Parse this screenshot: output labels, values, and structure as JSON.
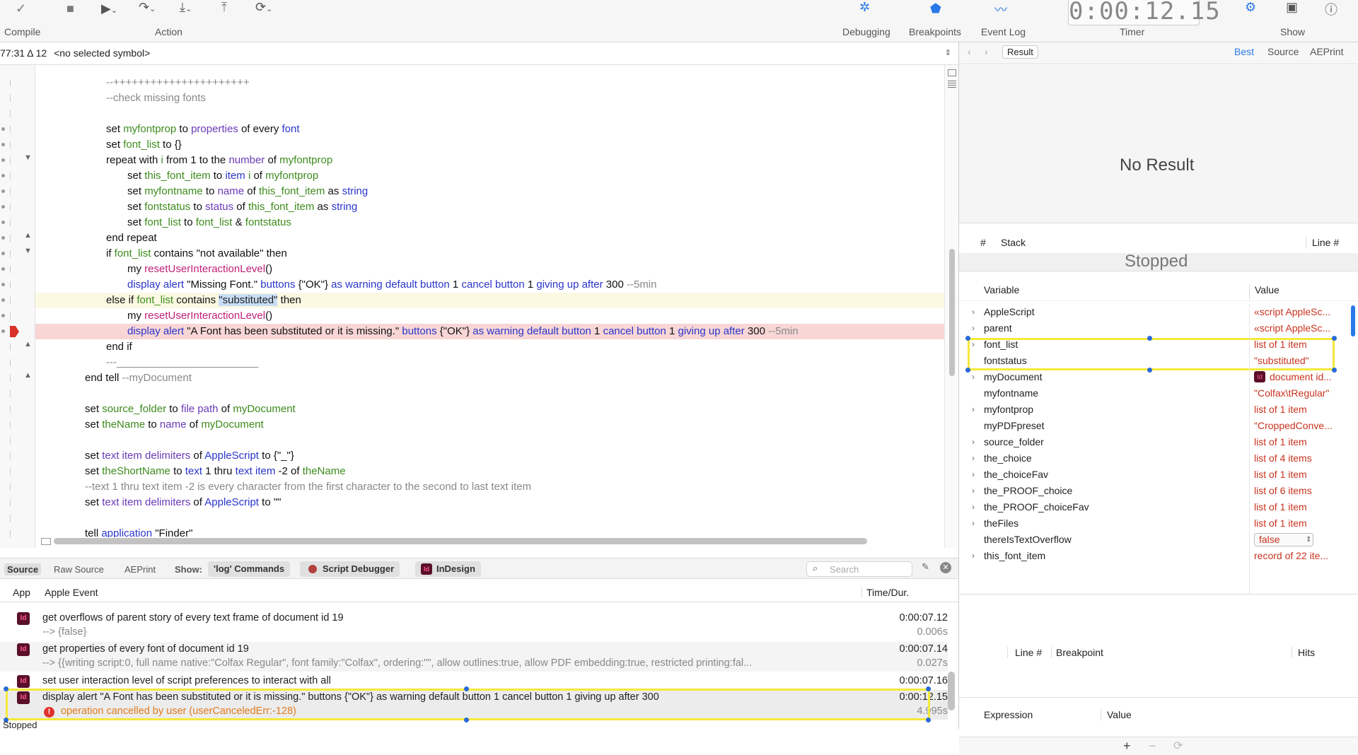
{
  "toolbar": {
    "compile": "Compile",
    "action": "Action",
    "debugging": "Debugging",
    "breakpoints": "Breakpoints",
    "event_log": "Event Log",
    "timer_label": "Timer",
    "show": "Show",
    "timer_value": "0:00:12.15"
  },
  "symbol_bar": {
    "position": "77:31 Δ 12",
    "symbol": "<no selected symbol>"
  },
  "code_lines": [
    {
      "t": [
        [
          "cm",
          "--++++++++++++++++++++++"
        ]
      ]
    },
    {
      "t": [
        [
          "cm",
          "--check missing fonts"
        ]
      ]
    },
    {
      "t": []
    },
    {
      "t": [
        [
          "kw",
          "set "
        ],
        [
          "v",
          "myfontprop"
        ],
        [
          "kw",
          " to "
        ],
        [
          "p",
          "properties"
        ],
        [
          "kw",
          " of every "
        ],
        [
          "cls",
          "font"
        ]
      ]
    },
    {
      "t": [
        [
          "kw",
          "set "
        ],
        [
          "v",
          "font_list"
        ],
        [
          "kw",
          " to {}"
        ]
      ]
    },
    {
      "t": [
        [
          "kw",
          "repeat with "
        ],
        [
          "v",
          "i"
        ],
        [
          "kw",
          " from 1 to the "
        ],
        [
          "p",
          "number"
        ],
        [
          "kw",
          " of "
        ],
        [
          "v",
          "myfontprop"
        ]
      ]
    },
    {
      "t": [
        [
          "kw",
          "set "
        ],
        [
          "v",
          "this_font_item"
        ],
        [
          "kw",
          " to "
        ],
        [
          "cls",
          "item"
        ],
        [
          "kw",
          " "
        ],
        [
          "v",
          "i"
        ],
        [
          "kw",
          " of "
        ],
        [
          "v",
          "myfontprop"
        ]
      ]
    },
    {
      "t": [
        [
          "kw",
          "set "
        ],
        [
          "v",
          "myfontname"
        ],
        [
          "kw",
          " to "
        ],
        [
          "p",
          "name"
        ],
        [
          "kw",
          " of "
        ],
        [
          "v",
          "this_font_item"
        ],
        [
          "kw",
          " as "
        ],
        [
          "cls",
          "string"
        ]
      ]
    },
    {
      "t": [
        [
          "kw",
          "set "
        ],
        [
          "v",
          "fontstatus"
        ],
        [
          "kw",
          " to "
        ],
        [
          "p",
          "status"
        ],
        [
          "kw",
          " of "
        ],
        [
          "v",
          "this_font_item"
        ],
        [
          "kw",
          " as "
        ],
        [
          "cls",
          "string"
        ]
      ]
    },
    {
      "t": [
        [
          "kw",
          "set "
        ],
        [
          "v",
          "font_list"
        ],
        [
          "kw",
          " to "
        ],
        [
          "v",
          "font_list"
        ],
        [
          "kw",
          " & "
        ],
        [
          "v",
          "fontstatus"
        ]
      ]
    },
    {
      "t": [
        [
          "kw",
          "end repeat"
        ]
      ]
    },
    {
      "t": [
        [
          "kw",
          "if "
        ],
        [
          "v",
          "font_list"
        ],
        [
          "kw",
          " contains \"not available\" then"
        ]
      ]
    },
    {
      "t": [
        [
          "kw",
          "my "
        ],
        [
          "h",
          "resetUserInteractionLevel"
        ],
        [
          "kw",
          "()"
        ]
      ]
    },
    {
      "t": [
        [
          "cls",
          "display alert"
        ],
        [
          "kw",
          " \"Missing Font.\" "
        ],
        [
          "cls",
          "buttons"
        ],
        [
          "kw",
          " {\"OK\"} "
        ],
        [
          "cls",
          "as warning default button"
        ],
        [
          "kw",
          " 1 "
        ],
        [
          "cls",
          "cancel button"
        ],
        [
          "kw",
          " 1 "
        ],
        [
          "cls",
          "giving up after"
        ],
        [
          "kw",
          " 300 "
        ],
        [
          "cm",
          "--5min"
        ]
      ]
    },
    {
      "t": [
        [
          "kw",
          "else if "
        ],
        [
          "v",
          "font_list"
        ],
        [
          "kw",
          " contains "
        ],
        [
          "sel",
          "\"substituted\""
        ],
        [
          "kw",
          " then"
        ]
      ]
    },
    {
      "t": [
        [
          "kw",
          "my "
        ],
        [
          "h",
          "resetUserInteractionLevel"
        ],
        [
          "kw",
          "()"
        ]
      ]
    },
    {
      "t": [
        [
          "cls",
          "display alert"
        ],
        [
          "kw",
          " \"A Font has been substituted or it is missing.\" "
        ],
        [
          "cls",
          "buttons"
        ],
        [
          "kw",
          " {\"OK\"} "
        ],
        [
          "cls",
          "as warning default button"
        ],
        [
          "kw",
          " 1 "
        ],
        [
          "cls",
          "cancel button"
        ],
        [
          "kw",
          " 1 "
        ],
        [
          "cls",
          "giving up after"
        ],
        [
          "kw",
          " 300 "
        ],
        [
          "cm",
          "--5min"
        ]
      ]
    },
    {
      "t": [
        [
          "kw",
          "end if"
        ]
      ]
    },
    {
      "t": [
        [
          "cm",
          "---________________________"
        ]
      ]
    },
    {
      "t": [
        [
          "kw",
          "end tell "
        ],
        [
          "cm",
          "--myDocument"
        ]
      ]
    },
    {
      "t": []
    },
    {
      "t": [
        [
          "kw",
          "set "
        ],
        [
          "v",
          "source_folder"
        ],
        [
          "kw",
          " to "
        ],
        [
          "p",
          "file path"
        ],
        [
          "kw",
          " of "
        ],
        [
          "v",
          "myDocument"
        ]
      ]
    },
    {
      "t": [
        [
          "kw",
          "set "
        ],
        [
          "v",
          "theName"
        ],
        [
          "kw",
          " to "
        ],
        [
          "p",
          "name"
        ],
        [
          "kw",
          " of "
        ],
        [
          "v",
          "myDocument"
        ]
      ]
    },
    {
      "t": []
    },
    {
      "t": [
        [
          "kw",
          "set "
        ],
        [
          "p",
          "text item delimiters"
        ],
        [
          "kw",
          " of "
        ],
        [
          "cls",
          "AppleScript"
        ],
        [
          "kw",
          " to {\"_\"}"
        ]
      ]
    },
    {
      "t": [
        [
          "kw",
          "set "
        ],
        [
          "v",
          "theShortName"
        ],
        [
          "kw",
          " to "
        ],
        [
          "cls",
          "text"
        ],
        [
          "kw",
          " 1 thru "
        ],
        [
          "cls",
          "text item"
        ],
        [
          "kw",
          " -2 of "
        ],
        [
          "v",
          "theName"
        ]
      ]
    },
    {
      "t": [
        [
          "cm",
          "--text 1 thru text item -2 is every character from the first character to the second to last text item"
        ]
      ]
    },
    {
      "t": [
        [
          "kw",
          "set "
        ],
        [
          "p",
          "text item delimiters"
        ],
        [
          "kw",
          " of "
        ],
        [
          "cls",
          "AppleScript"
        ],
        [
          "kw",
          " to \"\""
        ]
      ]
    },
    {
      "t": []
    },
    {
      "t": [
        [
          "kw",
          "tell "
        ],
        [
          "cls",
          "application"
        ],
        [
          "kw",
          " \"Finder\""
        ]
      ]
    }
  ],
  "log_bar": {
    "source": "Source",
    "raw_source": "Raw Source",
    "aeprint": "AEPrint",
    "show": "Show:",
    "log_commands": "'log' Commands",
    "script_debugger": "Script Debugger",
    "indesign": "InDesign",
    "search_placeholder": "Search"
  },
  "log_header": {
    "app": "App",
    "event": "Apple Event",
    "time": "Time/Dur."
  },
  "log_rows": [
    {
      "event": "get overflows of parent story of every text frame of document id 19",
      "result": "--> {false}",
      "time": "0:00:07.12",
      "dur": "0.006s"
    },
    {
      "event": "get properties of every font of document id 19",
      "result": "--> {{writing script:0, full name native:\"Colfax Regular\", font family:\"Colfax\", ordering:\"\", allow outlines:true, allow PDF embedding:true, restricted printing:fal...",
      "time": "0:00:07.14",
      "dur": "0.027s"
    },
    {
      "event": "set user interaction level of script preferences to interact with all",
      "result": "",
      "time": "0:00:07.16",
      "dur": ""
    },
    {
      "event": "display alert \"A Font has been substituted or it is missing.\" buttons {\"OK\"} as warning default button 1 cancel button 1 giving up after 300",
      "result": "operation cancelled by user (userCanceledErr:-128)",
      "time": "0:00:12.15",
      "dur": "4.995s"
    }
  ],
  "status": "Stopped",
  "result_bar": {
    "result": "Result",
    "best": "Best",
    "source": "Source",
    "aeprint": "AEPrint"
  },
  "result_panel": {
    "empty": "No Result"
  },
  "stack": {
    "num": "#",
    "stack": "Stack",
    "line": "Line #",
    "status": "Stopped"
  },
  "vars_header": {
    "variable": "Variable",
    "value": "Value"
  },
  "variables": [
    {
      "name": "AppleScript",
      "value": "«script AppleSc...",
      "exp": true
    },
    {
      "name": "parent",
      "value": "«script AppleSc...",
      "exp": true
    },
    {
      "name": "font_list",
      "value": "list of 1 item",
      "exp": true
    },
    {
      "name": "fontstatus",
      "value": "\"substituted\"",
      "exp": false
    },
    {
      "name": "myDocument",
      "value": "document id...",
      "exp": true
    },
    {
      "name": "myfontname",
      "value": "\"Colfax\\tRegular\"",
      "exp": false
    },
    {
      "name": "myfontprop",
      "value": "list of 1 item",
      "exp": true
    },
    {
      "name": "myPDFpreset",
      "value": "\"CroppedConve...",
      "exp": false
    },
    {
      "name": "source_folder",
      "value": "list of 1 item",
      "exp": true
    },
    {
      "name": "the_choice",
      "value": "list of 4 items",
      "exp": true
    },
    {
      "name": "the_choiceFav",
      "value": "list of 1 item",
      "exp": true
    },
    {
      "name": "the_PROOF_choice",
      "value": "list of 6 items",
      "exp": true
    },
    {
      "name": "the_PROOF_choiceFav",
      "value": "list of 1 item",
      "exp": true
    },
    {
      "name": "theFiles",
      "value": "list of 1 item",
      "exp": true
    },
    {
      "name": "thereIsTextOverflow",
      "value": "false",
      "exp": false
    },
    {
      "name": "this_font_item",
      "value": "record of 22 ite...",
      "exp": true
    }
  ],
  "breakpoints_header": {
    "line": "Line #",
    "breakpoint": "Breakpoint",
    "hits": "Hits"
  },
  "expr_header": {
    "expression": "Expression",
    "value": "Value"
  }
}
